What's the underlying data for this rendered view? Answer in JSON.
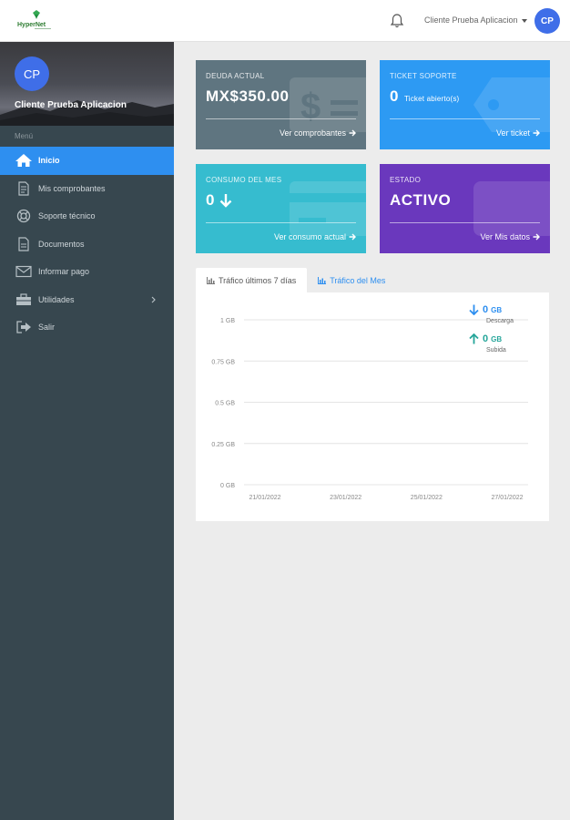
{
  "header": {
    "logo_text": "HyperNet",
    "user_name": "Cliente Prueba Aplicacion",
    "avatar_initials": "CP"
  },
  "sidebar": {
    "avatar_initials": "CP",
    "user_name": "Cliente Prueba Aplicacion",
    "menu_heading": "Menú",
    "items": [
      {
        "label": "Inicio",
        "icon": "home-icon",
        "active": true
      },
      {
        "label": "Mis comprobantes",
        "icon": "file-icon"
      },
      {
        "label": "Soporte técnico",
        "icon": "lifebuoy-icon"
      },
      {
        "label": "Documentos",
        "icon": "document-icon"
      },
      {
        "label": "Informar pago",
        "icon": "envelope-icon"
      },
      {
        "label": "Utilidades",
        "icon": "toolbox-icon",
        "has_submenu": true
      },
      {
        "label": "Salir",
        "icon": "sign-out-icon"
      }
    ]
  },
  "cards": {
    "debt": {
      "label": "DEUDA ACTUAL",
      "value": "MX$350.00",
      "link": "Ver comprobantes",
      "color": "#5f7580"
    },
    "ticket": {
      "label": "TICKET SOPORTE",
      "value": "0",
      "sub": "Ticket abierto(s)",
      "link": "Ver ticket",
      "color": "#2d9af3"
    },
    "usage": {
      "label": "CONSUMO DEL MES",
      "value": "0",
      "link": "Ver consumo actual",
      "color": "#36bccf"
    },
    "status": {
      "label": "ESTADO",
      "value": "ACTIVO",
      "link": "Ver Mis datos",
      "color": "#6a38bd"
    }
  },
  "tabs": [
    {
      "label": "Tráfico últimos 7 días",
      "active": true
    },
    {
      "label": "Tráfico del Mes",
      "active": false
    }
  ],
  "legend": {
    "download": {
      "value": "0",
      "unit": "GB",
      "caption": "Descarga",
      "color": "#2e8ff0"
    },
    "upload": {
      "value": "0",
      "unit": "GB",
      "caption": "Subida",
      "color": "#26a69a"
    }
  },
  "chart_data": {
    "type": "line",
    "y_ticks": [
      "1 GB",
      "0.75 GB",
      "0.5 GB",
      "0.25 GB",
      "0 GB"
    ],
    "ylim": [
      0,
      1
    ],
    "x_ticks": [
      "21/01/2022",
      "23/01/2022",
      "25/01/2022",
      "27/01/2022"
    ],
    "series": [
      {
        "name": "Descarga",
        "values": []
      },
      {
        "name": "Subida",
        "values": []
      }
    ],
    "grid": true
  }
}
